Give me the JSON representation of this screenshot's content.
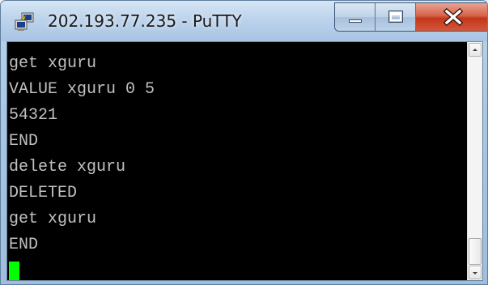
{
  "window": {
    "title": "202.193.77.235 - PuTTY",
    "icon": "putty-icon",
    "controls": {
      "minimize_icon": "minimize-icon",
      "maximize_icon": "maximize-icon",
      "close_icon": "close-icon"
    }
  },
  "terminal": {
    "background": "#000000",
    "foreground": "#c0c0c0",
    "cursor_color": "#00ff00",
    "lines": [
      "get xguru",
      "VALUE xguru 0 5",
      "54321",
      "END",
      "delete xguru",
      "DELETED",
      "get xguru",
      "END"
    ]
  },
  "scrollbar": {
    "up_icon": "scroll-up-arrow-icon",
    "down_icon": "scroll-down-arrow-icon",
    "position": 1.0
  }
}
